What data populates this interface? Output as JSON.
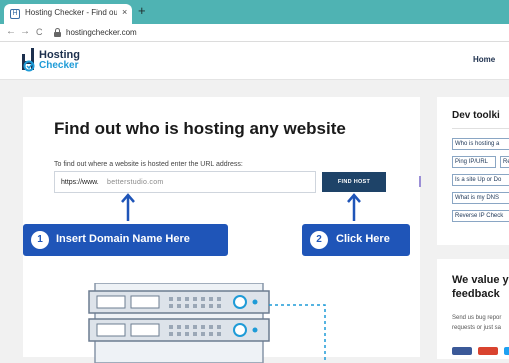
{
  "browser": {
    "tab_title": "Hosting Checker - Find out who",
    "tab_favicon": "H",
    "tab_close": "×",
    "new_tab": "+",
    "url": "hostingchecker.com",
    "nav_back": "←",
    "nav_forward": "→",
    "nav_reload": "C"
  },
  "header": {
    "logo_line1": "Hosting",
    "logo_line2": "Checker",
    "nav_home": "Home"
  },
  "main": {
    "heading": "Find out who is hosting any website",
    "hint": "To find out where a website is hosted enter the URL address:",
    "input_prefix": "https://www.",
    "input_value": "betterstudio.com",
    "find_button": "FIND HOST"
  },
  "callouts": {
    "c1_num": "1",
    "c1_label": "Insert Domain Name Here",
    "c2_num": "2",
    "c2_label": "Click Here"
  },
  "sidebar": {
    "dev_title": "Dev toolki",
    "tools": [
      "Who is hosting a",
      "Ping IP/URL",
      "Re",
      "Is a site Up or Do",
      "What is my DNS",
      "Reverse IP Check"
    ],
    "value_title": "We value y feedback",
    "send_text_1": "Send us bug repor",
    "send_text_2": "requests or just sa"
  },
  "colors": {
    "tabbar": "#4fb3b3",
    "brand_navy": "#1c2f4d",
    "brand_blue": "#1e9bd7",
    "button": "#1e4368",
    "callout": "#1f55b8"
  },
  "icons": [
    "favicon-icon",
    "close-icon",
    "plus-icon",
    "back-icon",
    "forward-icon",
    "reload-icon",
    "lock-icon",
    "logo-icon",
    "up-arrow-icon",
    "server-illustration"
  ]
}
